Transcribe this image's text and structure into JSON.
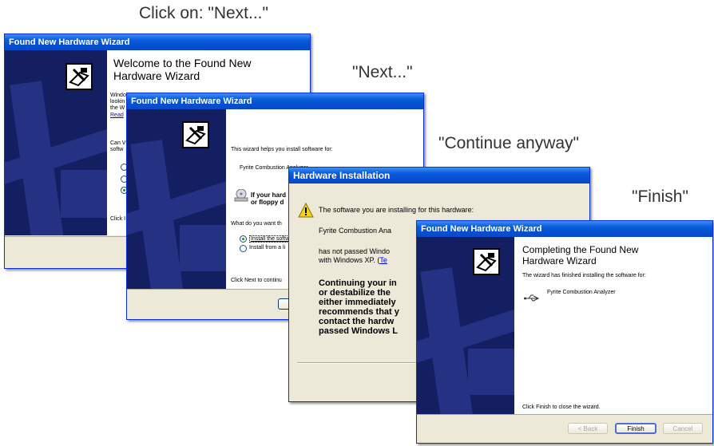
{
  "captions": {
    "step1": "Click on:  \"Next...\"",
    "step2": "\"Next...\"",
    "step3": "\"Continue anyway\"",
    "step4": "\"Finish\""
  },
  "colors": {
    "title_bar": "#0a5ddd",
    "sidebar": "#141f62",
    "dialog_bg": "#ece9d8"
  },
  "window1": {
    "title": "Found New Hardware Wizard",
    "heading_line1": "Welcome to the Found New",
    "heading_line2": "Hardware Wizard",
    "text_lines": [
      "Windo",
      "lookin",
      "the W"
    ],
    "link": "Read",
    "question_lines": [
      "Can V",
      "softw"
    ],
    "footer_text": "Click I"
  },
  "window2": {
    "title": "Found New Hardware Wizard",
    "intro": "This wizard helps you install software for:",
    "device": "Fyrite Combustion Analyzer",
    "cd_line1": "If your hard",
    "cd_line2": "or floppy d",
    "question": "What do you want th",
    "option_auto": "Install the softw",
    "option_manual": "Install from a li",
    "footer_text": "Click Next to continu"
  },
  "window3": {
    "title": "Hardware Installation",
    "line1": "The software you are installing for this hardware:",
    "device": "Fyrite Combustion Ana",
    "logo_line1": "has not passed Windo",
    "logo_line2": "with Windows XP. (",
    "logo_link": "Te",
    "warning_lines": [
      "Continuing your in",
      "or destabilize the",
      "either immediately",
      "recommends that y",
      "contact the hardw",
      "passed Windows L"
    ]
  },
  "window4": {
    "title": "Found New Hardware Wizard",
    "heading_line1": "Completing the Found New",
    "heading_line2": "Hardware Wizard",
    "finished_text": "The wizard has finished installing the software for:",
    "device": "Fyrite Combustion Analyzer",
    "close_text": "Click Finish to close the wizard.",
    "back_button": "< Back",
    "finish_button": "Finish",
    "cancel_button": "Cancel"
  }
}
